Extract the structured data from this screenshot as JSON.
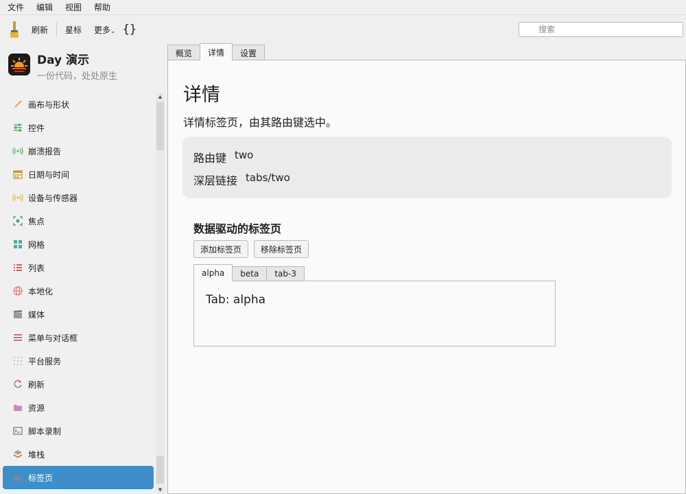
{
  "menubar": {
    "items": [
      "文件",
      "编辑",
      "视图",
      "帮助"
    ]
  },
  "toolbar": {
    "refresh_label": "刷新",
    "star_label": "星标",
    "more_label": "更多",
    "more_caret": "⌄",
    "braces": "{}",
    "search_placeholder": "搜索"
  },
  "brand": {
    "title": "Day 演示",
    "subtitle": "一份代码，处处原生"
  },
  "sidebar": {
    "items": [
      {
        "label": "画布与形状",
        "icon": "brush-icon"
      },
      {
        "label": "控件",
        "icon": "sliders-icon"
      },
      {
        "label": "崩溃报告",
        "icon": "broadcast-icon"
      },
      {
        "label": "日期与时间",
        "icon": "calendar-icon"
      },
      {
        "label": "设备与传感器",
        "icon": "sensor-icon"
      },
      {
        "label": "焦点",
        "icon": "focus-icon"
      },
      {
        "label": "网格",
        "icon": "grid-icon"
      },
      {
        "label": "列表",
        "icon": "list-icon"
      },
      {
        "label": "本地化",
        "icon": "globe-icon"
      },
      {
        "label": "媒体",
        "icon": "clapper-icon"
      },
      {
        "label": "菜单与对话框",
        "icon": "menu-icon"
      },
      {
        "label": "平台服务",
        "icon": "dots-icon"
      },
      {
        "label": "刷新",
        "icon": "refresh-icon"
      },
      {
        "label": "资源",
        "icon": "folder-icon"
      },
      {
        "label": "脚本录制",
        "icon": "terminal-icon"
      },
      {
        "label": "堆栈",
        "icon": "stack-icon"
      },
      {
        "label": "标签页",
        "icon": "tabs-icon",
        "active": true
      }
    ]
  },
  "tabs": [
    {
      "label": "概览"
    },
    {
      "label": "详情",
      "active": true
    },
    {
      "label": "设置"
    }
  ],
  "detail": {
    "title": "详情",
    "description": "详情标签页，由其路由键选中。",
    "route_key_label": "路由键",
    "route_key_value": "two",
    "deep_link_label": "深层链接",
    "deep_link_value": "tabs/two"
  },
  "data_tabs": {
    "title": "数据驱动的标签页",
    "add_label": "添加标签页",
    "remove_label": "移除标签页",
    "tabs": [
      "alpha",
      "beta",
      "tab-3"
    ],
    "active_index": 0,
    "panel_text": "Tab: alpha"
  },
  "colors": {
    "accent": "#3d8ec9"
  }
}
